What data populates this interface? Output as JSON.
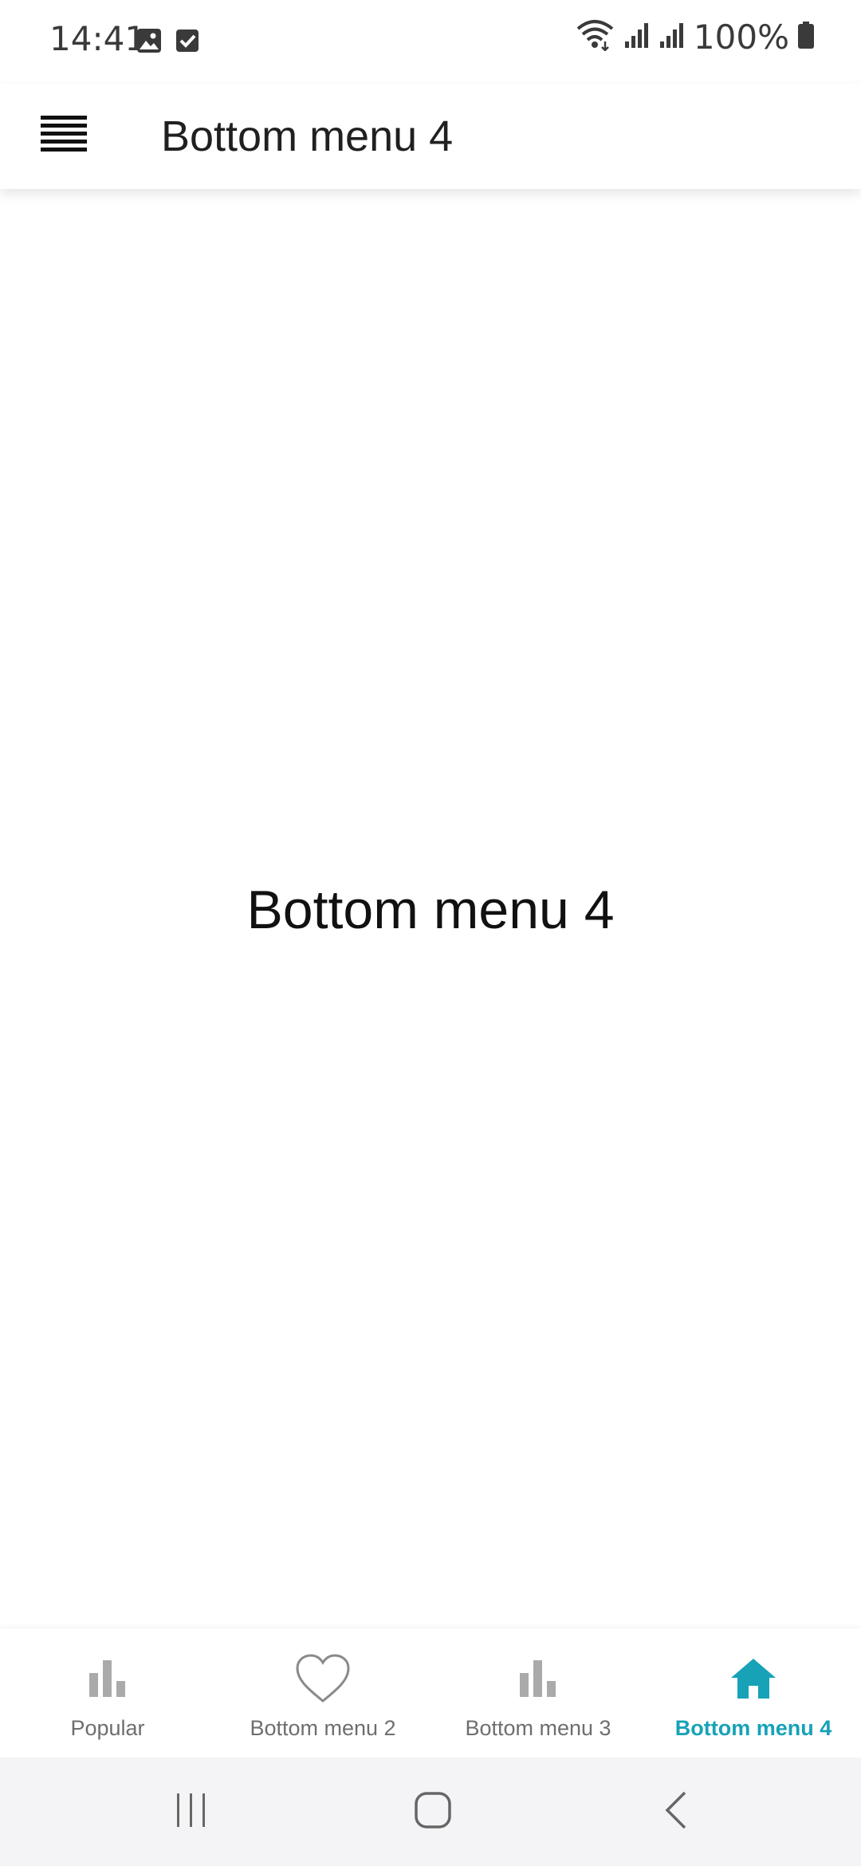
{
  "status_bar": {
    "time": "14:41",
    "battery_text": "100%",
    "icons": [
      "image-icon",
      "checkbox-icon",
      "wifi-icon",
      "signal-icon",
      "signal-icon",
      "battery-icon"
    ]
  },
  "app_bar": {
    "title": "Bottom menu 4",
    "menu_icon": "hamburger-menu-icon"
  },
  "content": {
    "text": "Bottom menu 4"
  },
  "bottom_nav": {
    "accent_color": "#17a2b8",
    "inactive_color": "#aaaaaa",
    "items": [
      {
        "label": "Popular",
        "icon": "bar-chart-icon",
        "active": false
      },
      {
        "label": "Bottom menu 2",
        "icon": "heart-icon",
        "active": false
      },
      {
        "label": "Bottom menu 3",
        "icon": "bar-chart-icon",
        "active": false
      },
      {
        "label": "Bottom menu 4",
        "icon": "home-icon",
        "active": true
      }
    ]
  },
  "system_nav": {
    "buttons": [
      "recents-icon",
      "home-button-icon",
      "back-icon"
    ]
  }
}
